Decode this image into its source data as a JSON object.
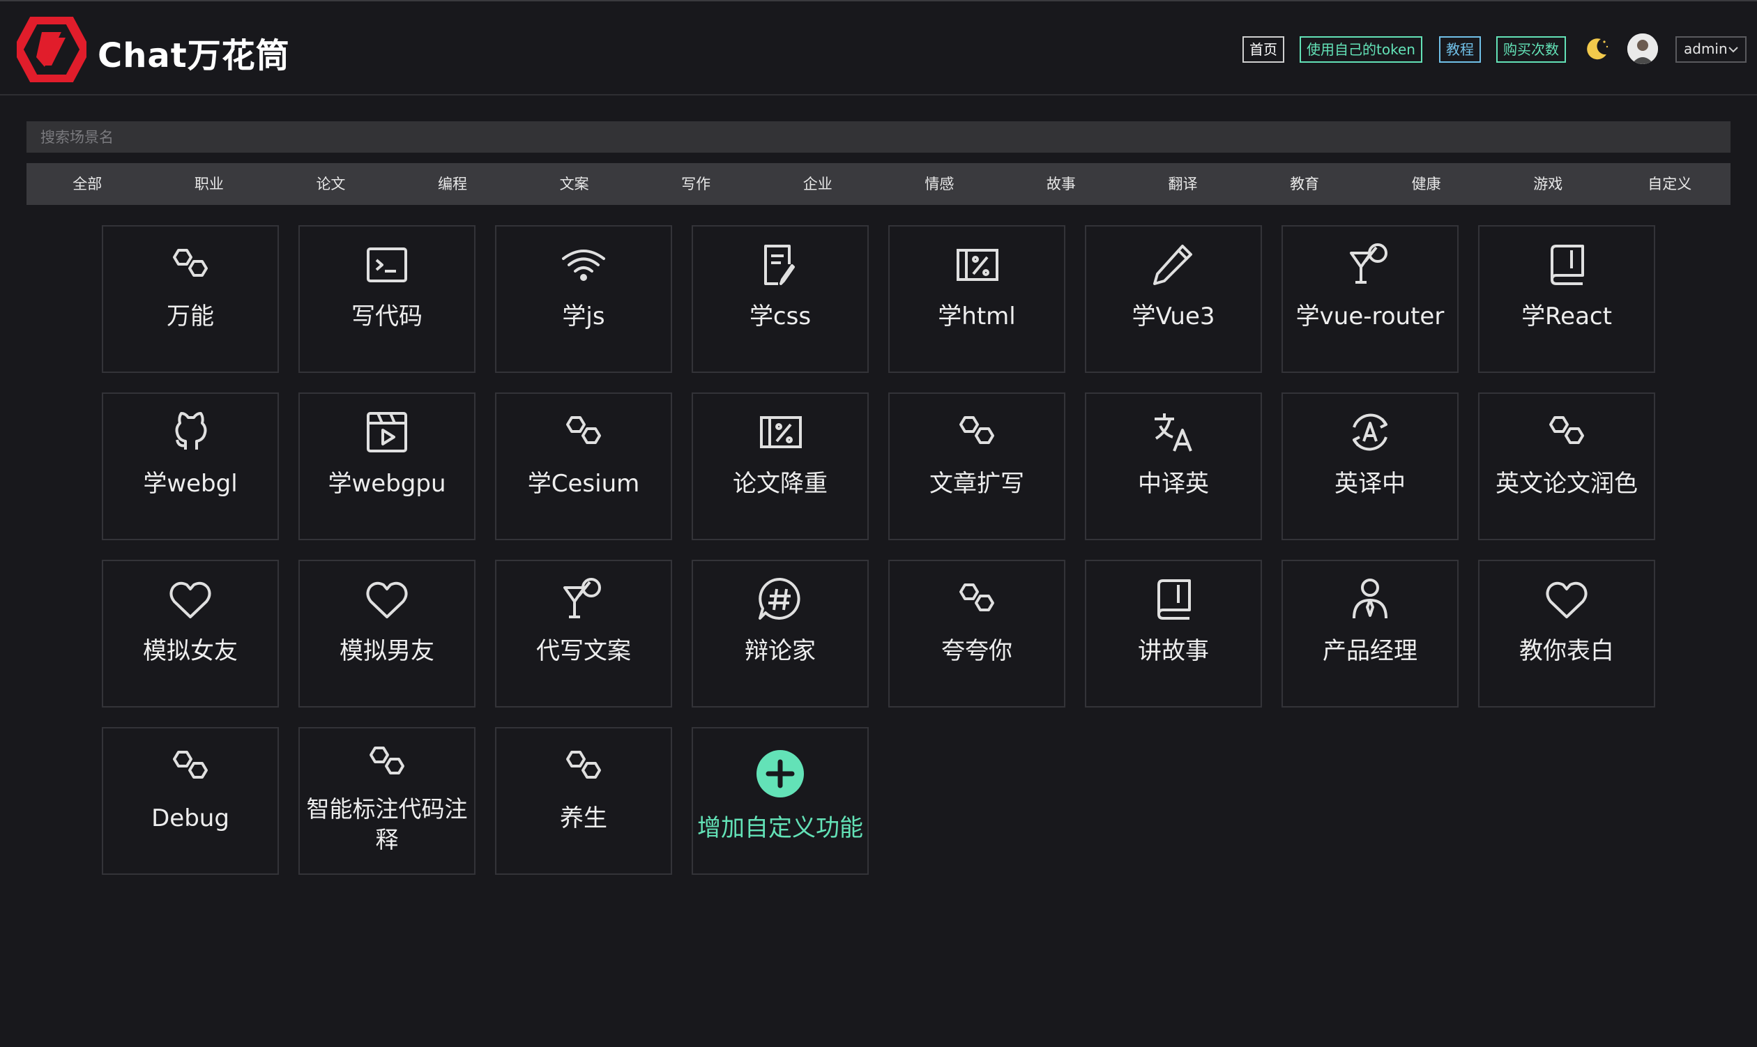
{
  "header": {
    "brand": "Chat万花筒",
    "nav": [
      {
        "label": "首页",
        "color": "#ffffff"
      },
      {
        "label": "使用自己的token",
        "color": "#63e2b7"
      },
      {
        "label": "教程",
        "color": "#70c0e8"
      },
      {
        "label": "购买次数",
        "color": "#63e2b7"
      }
    ],
    "user": "admin",
    "theme_icon": "moon-icon",
    "colors": {
      "brand_red": "#e11d2b",
      "accent_green": "#63e2b7",
      "accent_blue": "#70c0e8",
      "moon": "#f2c94c"
    }
  },
  "search": {
    "placeholder": "搜索场景名",
    "value": ""
  },
  "categories": [
    "全部",
    "职业",
    "论文",
    "编程",
    "文案",
    "写作",
    "企业",
    "情感",
    "故事",
    "翻译",
    "教育",
    "健康",
    "游戏",
    "自定义"
  ],
  "scenes": [
    {
      "label": "万能",
      "icon": "hexagons-icon"
    },
    {
      "label": "写代码",
      "icon": "terminal-icon"
    },
    {
      "label": "学js",
      "icon": "wifi-icon"
    },
    {
      "label": "学css",
      "icon": "file-edit-icon"
    },
    {
      "label": "学html",
      "icon": "percent-box-icon"
    },
    {
      "label": "学Vue3",
      "icon": "pencil-icon"
    },
    {
      "label": "学vue-router",
      "icon": "cocktail-icon"
    },
    {
      "label": "学React",
      "icon": "book-icon"
    },
    {
      "label": "学webgl",
      "icon": "github-icon"
    },
    {
      "label": "学webgpu",
      "icon": "video-play-icon"
    },
    {
      "label": "学Cesium",
      "icon": "hexagons-icon"
    },
    {
      "label": "论文降重",
      "icon": "percent-box-icon"
    },
    {
      "label": "文章扩写",
      "icon": "hexagons-icon"
    },
    {
      "label": "中译英",
      "icon": "translate-icon"
    },
    {
      "label": "英译中",
      "icon": "language-a-icon"
    },
    {
      "label": "英文论文润色",
      "icon": "hexagons-icon"
    },
    {
      "label": "模拟女友",
      "icon": "heart-icon"
    },
    {
      "label": "模拟男友",
      "icon": "heart-icon"
    },
    {
      "label": "代写文案",
      "icon": "cocktail-icon"
    },
    {
      "label": "辩论家",
      "icon": "hashtag-chat-icon"
    },
    {
      "label": "夸夸你",
      "icon": "hexagons-icon"
    },
    {
      "label": "讲故事",
      "icon": "book-icon"
    },
    {
      "label": "产品经理",
      "icon": "person-tie-icon"
    },
    {
      "label": "教你表白",
      "icon": "heart-icon"
    },
    {
      "label": "Debug",
      "icon": "hexagons-icon"
    },
    {
      "label": "智能标注代码注释",
      "icon": "hexagons-icon"
    },
    {
      "label": "养生",
      "icon": "hexagons-icon"
    },
    {
      "label": "增加自定义功能",
      "icon": "plus-circle-icon"
    }
  ]
}
